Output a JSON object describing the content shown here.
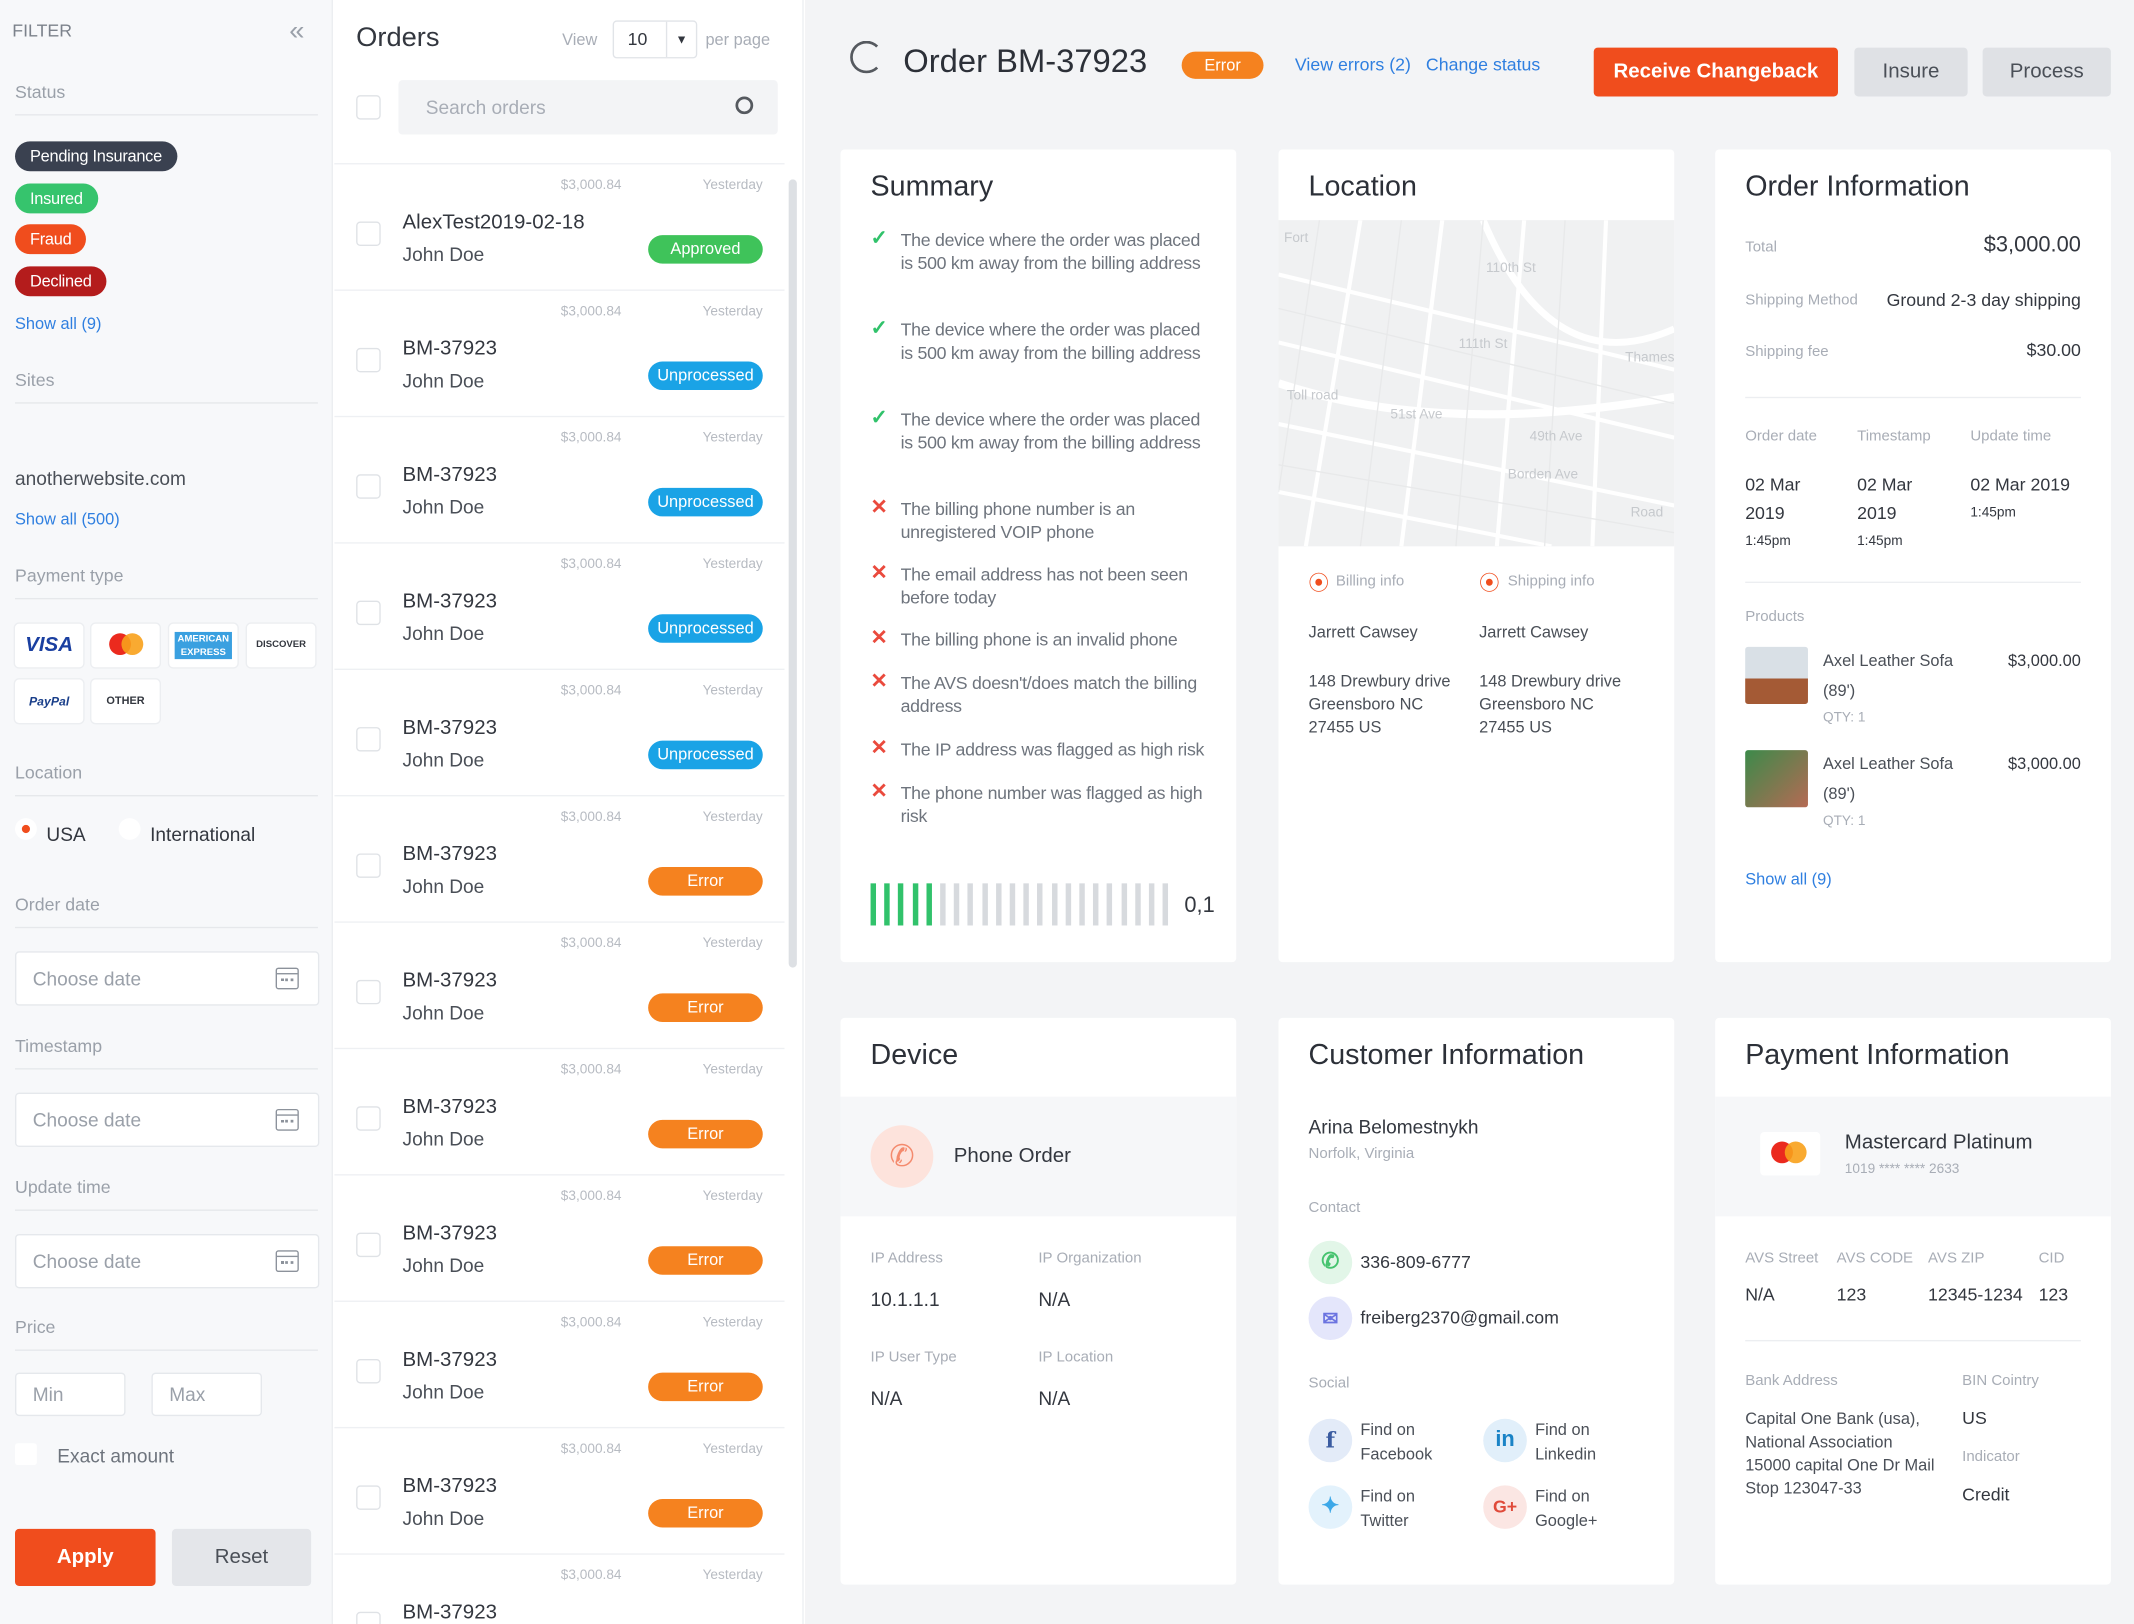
{
  "filter": {
    "title": "FILTER",
    "status_label": "Status",
    "chips": [
      {
        "label": "Pending Insurance",
        "color": "#3a4150"
      },
      {
        "label": "Insured",
        "color": "#36c46d"
      },
      {
        "label": "Fraud",
        "color": "#f04d1d"
      },
      {
        "label": "Declined",
        "color": "#b41c1c"
      }
    ],
    "show_all_status": "Show all (9)",
    "sites_label": "Sites",
    "site": "anotherwebsite.com",
    "show_all_sites": "Show all (500)",
    "payment_label": "Payment type",
    "cards": [
      "VISA",
      "",
      "AMERICAN EXPRESS",
      "DISCOVER",
      "PayPal",
      "OTHER"
    ],
    "location_label": "Location",
    "loc_usa": "USA",
    "loc_intl": "International",
    "order_date_label": "Order date",
    "timestamp_label": "Timestamp",
    "update_label": "Update time",
    "date_placeholder": "Choose date",
    "price_label": "Price",
    "min": "Min",
    "max": "Max",
    "exact": "Exact amount",
    "apply": "Apply",
    "reset": "Reset"
  },
  "orders": {
    "title": "Orders",
    "view": "View",
    "per_page_value": "10",
    "per_page": "per page",
    "search_placeholder": "Search orders",
    "rows": [
      {
        "amount": "$3,000.84",
        "when": "Yesterday",
        "id": "AlexTest2019-02-18",
        "name": "John Doe",
        "status": "Approved",
        "color": "#3fc35a"
      },
      {
        "amount": "$3,000.84",
        "when": "Yesterday",
        "id": "BM-37923",
        "name": "John Doe",
        "status": "Unprocessed",
        "color": "#1aa3e6"
      },
      {
        "amount": "$3,000.84",
        "when": "Yesterday",
        "id": "BM-37923",
        "name": "John Doe",
        "status": "Unprocessed",
        "color": "#1aa3e6"
      },
      {
        "amount": "$3,000.84",
        "when": "Yesterday",
        "id": "BM-37923",
        "name": "John Doe",
        "status": "Unprocessed",
        "color": "#1aa3e6"
      },
      {
        "amount": "$3,000.84",
        "when": "Yesterday",
        "id": "BM-37923",
        "name": "John Doe",
        "status": "Unprocessed",
        "color": "#1aa3e6"
      },
      {
        "amount": "$3,000.84",
        "when": "Yesterday",
        "id": "BM-37923",
        "name": "John Doe",
        "status": "Error",
        "color": "#f5821f"
      },
      {
        "amount": "$3,000.84",
        "when": "Yesterday",
        "id": "BM-37923",
        "name": "John Doe",
        "status": "Error",
        "color": "#f5821f"
      },
      {
        "amount": "$3,000.84",
        "when": "Yesterday",
        "id": "BM-37923",
        "name": "John Doe",
        "status": "Error",
        "color": "#f5821f"
      },
      {
        "amount": "$3,000.84",
        "when": "Yesterday",
        "id": "BM-37923",
        "name": "John Doe",
        "status": "Error",
        "color": "#f5821f"
      },
      {
        "amount": "$3,000.84",
        "when": "Yesterday",
        "id": "BM-37923",
        "name": "John Doe",
        "status": "Error",
        "color": "#f5821f"
      },
      {
        "amount": "$3,000.84",
        "when": "Yesterday",
        "id": "BM-37923",
        "name": "John Doe",
        "status": "Error",
        "color": "#f5821f"
      },
      {
        "amount": "$3,000.84",
        "when": "Yesterday",
        "id": "BM-37923",
        "name": "",
        "status": "",
        "color": ""
      }
    ]
  },
  "detail": {
    "title": "Order BM-37923",
    "status": "Error",
    "view_errors": "View errors (2)",
    "change_status": "Change status",
    "receive": "Receive Changeback",
    "insure": "Insure",
    "process": "Process",
    "summary": {
      "title": "Summary",
      "items": [
        {
          "ok": true,
          "text": "The device where the order was placed is 500 km away from the billing address"
        },
        {
          "ok": true,
          "text": "The device where the order was placed is 500 km away from the billing address"
        },
        {
          "ok": true,
          "text": "The device where the order was placed is 500 km away from the billing address"
        },
        {
          "ok": false,
          "text": "The billing phone number is an unregistered VOIP phone"
        },
        {
          "ok": false,
          "text": "The email address has not been seen before today"
        },
        {
          "ok": false,
          "text": "The billing phone is an invalid phone"
        },
        {
          "ok": false,
          "text": "The AVS doesn't/does match the billing address"
        },
        {
          "ok": false,
          "text": "The IP address was flagged as high risk"
        },
        {
          "ok": false,
          "text": "The phone number was flagged as high risk"
        }
      ],
      "score": "0,1",
      "score_fraction": 0.1
    },
    "location": {
      "title": "Location",
      "billing_label": "Billing info",
      "shipping_label": "Shipping info",
      "billing_name": "Jarrett Cawsey",
      "billing_addr": [
        "148 Drewbury drive",
        "Greensboro NC",
        "27455 US"
      ],
      "shipping_name": "Jarrett Cawsey",
      "shipping_addr": [
        "148 Drewbury drive",
        "Greensboro NC",
        "27455 US"
      ]
    },
    "order_info": {
      "title": "Order Information",
      "total_label": "Total",
      "total": "$3,000.00",
      "ship_method_label": "Shipping Method",
      "ship_method": "Ground 2-3 day shipping",
      "ship_fee_label": "Shipping fee",
      "ship_fee": "$30.00",
      "order_date_label": "Order date",
      "timestamp_label": "Timestamp",
      "update_label": "Update time",
      "order_date": [
        "02 Mar",
        "2019",
        "1:45pm"
      ],
      "timestamp": [
        "02 Mar",
        "2019",
        "1:45pm"
      ],
      "update": [
        "02 Mar 2019",
        "1:45pm"
      ],
      "products_label": "Products",
      "products": [
        {
          "name": "Axel Leather Sofa",
          "size": "(89')",
          "qty": "QTY: 1",
          "price": "$3,000.00"
        },
        {
          "name": "Axel Leather Sofa",
          "size": "(89')",
          "qty": "QTY: 1",
          "price": "$3,000.00"
        }
      ],
      "show_all": "Show all (9)"
    },
    "device": {
      "title": "Device",
      "type": "Phone Order",
      "ip_label": "IP Address",
      "ip": "10.1.1.1",
      "org_label": "IP Organization",
      "org": "N/A",
      "utype_label": "IP User Type",
      "utype": "N/A",
      "iploc_label": "IP Location",
      "iploc": "N/A"
    },
    "customer": {
      "title": "Customer Information",
      "name": "Arina Belomestnykh",
      "place": "Norfolk, Virginia",
      "contact_label": "Contact",
      "phone": "336-809-6777",
      "email": "freiberg2370@gmail.com",
      "social_label": "Social",
      "social": [
        {
          "l1": "Find on",
          "l2": "Facebook"
        },
        {
          "l1": "Find on",
          "l2": "Linkedin"
        },
        {
          "l1": "Find on",
          "l2": "Twitter"
        },
        {
          "l1": "Find on",
          "l2": "Google+"
        }
      ]
    },
    "payment": {
      "title": "Payment Information",
      "card_name": "Mastercard Platinum",
      "card_number": "1019 **** **** 2633",
      "avs_street_label": "AVS Street",
      "avs_code_label": "AVS CODE",
      "avs_zip_label": "AVS ZIP",
      "cid_label": "CID",
      "avs_street": "N/A",
      "avs_code": "123",
      "avs_zip": "12345-1234",
      "cid": "123",
      "bank_label": "Bank Address",
      "bank": [
        "Capital One Bank (usa),",
        "National Association",
        "15000 capital One Dr Mail",
        "Stop 123047-33"
      ],
      "bin_label": "BIN Cointry",
      "bin": "US",
      "indicator_label": "Indicator",
      "indicator": "Credit"
    }
  },
  "map_labels": [
    "Fort",
    "110th St",
    "111th St",
    "Thames",
    "49th Ave",
    "Borden Ave",
    "Road",
    "51st Ave",
    "Toll road"
  ]
}
